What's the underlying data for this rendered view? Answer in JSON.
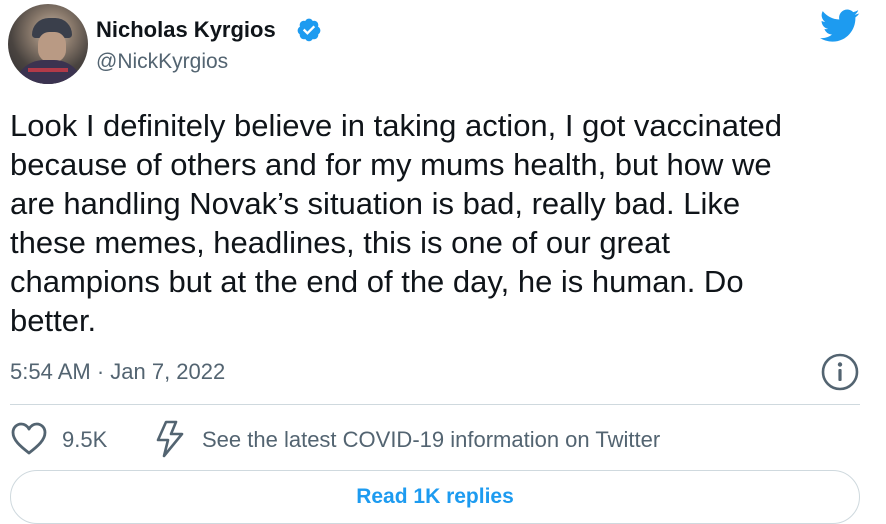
{
  "author": {
    "name": "Nicholas Kyrgios",
    "handle": "@NickKyrgios",
    "verified_icon": "verified-badge-icon",
    "avatar_icon": "profile-photo"
  },
  "tweet": {
    "text": "Look I definitely believe in taking action, I got vaccinated\nbecause of others and for my mums health, but how we\nare handling Novak’s situation is bad, really bad. Like\nthese memes, headlines, this is one of our great\nchampions but at the end of the day, he is human. Do\nbetter.",
    "timestamp": "5:54 AM · Jan 7, 2022"
  },
  "actions": {
    "like_count": "9.5K",
    "covid_info": "See the latest COVID-19 information on Twitter",
    "replies_button": "Read 1K replies"
  },
  "colors": {
    "accent": "#1d9bf0",
    "secondary_text": "#536471",
    "divider": "#cfd9de"
  }
}
